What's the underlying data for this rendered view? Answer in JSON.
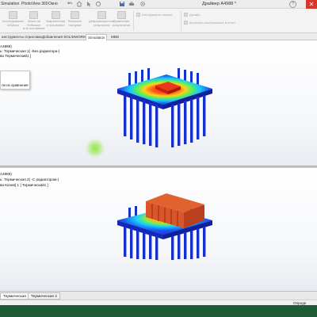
{
  "menu": {
    "items": [
      "Simulation",
      "PhotoView 360",
      "Окно"
    ],
    "doc_title": "Драйвер A4988 *",
    "help_glyph": "?",
    "close_glyph": "✕"
  },
  "ribbon": {
    "buttons": [
      "Исследование\nобъекта",
      "Эскиз на\nбобышка\nили основание",
      "Закрепления\nи основание",
      "Внешние\nнагрузки",
      "Деформационная\nрезультаты",
      "Сравнение\nрезультатов"
    ],
    "small_items": [
      "Инструменты эпюры",
      "Дизайн",
      "Включить изображение в отчет"
    ]
  },
  "tabs": [
    {
      "label": "инструменты отрисовки"
    },
    {
      "label": "Добавления SOLIDWORKS"
    },
    {
      "label": "Simulation"
    },
    {
      "label": "MBD"
    }
  ],
  "viewport_top": {
    "lines": [
      "A4988)",
      "ь: Термическая 1( -Без радиатора-)",
      "ва Термический1 ]"
    ],
    "popup_text": "ли из сравнения"
  },
  "viewport_bottom": {
    "lines": [
      "A4988)",
      "ь: Термическая 2( -С радиатором-)",
      "ва Копия[ 1 ] Термический1 ]"
    ]
  },
  "sheet_tabs": [
    {
      "label": "Термическая 1"
    },
    {
      "label": "Термическая 2"
    }
  ],
  "status": {
    "text": "Опреде"
  }
}
